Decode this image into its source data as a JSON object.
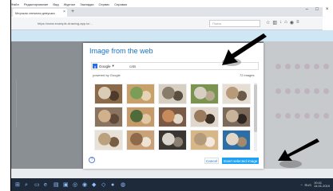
{
  "menubar": [
    "Файл",
    "Редактирование",
    "Вид",
    "Журнал",
    "Закладки",
    "Сервис",
    "Справка"
  ],
  "browser": {
    "tab_title": "Мерзкая снежная девушка",
    "url": "https://www.example-drawing-app.io/...",
    "search_placeholder": "Поиск"
  },
  "dialog": {
    "title": "Image from the web",
    "provider": "Google",
    "query": "cats",
    "powered_by": "powered by Google",
    "count": "72 images",
    "help": "?",
    "cancel_label": "Cancel",
    "insert_label": "Insert selected image"
  },
  "images": [
    {
      "colors": [
        "#8b6a4a",
        "#d9cbb5",
        "#4d3b2c"
      ]
    },
    {
      "colors": [
        "#c8a06a",
        "#7a9e58",
        "#e5d3b4"
      ]
    },
    {
      "colors": [
        "#d8cfc3",
        "#8a7c6a",
        "#5a4e40"
      ]
    },
    {
      "colors": [
        "#7a9450",
        "#d7d0c2",
        "#b9a890"
      ]
    },
    {
      "colors": [
        "#e7ded3",
        "#b79a7a",
        "#6b5a4a"
      ]
    },
    {
      "colors": [
        "#8a7460",
        "#d0b18c",
        "#5f4a3a"
      ]
    },
    {
      "colors": [
        "#c79a6a",
        "#4f6b3a",
        "#e2c9a6"
      ]
    },
    {
      "colors": [
        "#7a5a44",
        "#c78a5a",
        "#e2d8c8"
      ]
    },
    {
      "colors": [
        "#e0d6cc",
        "#9b7b5e",
        "#3e3228"
      ]
    },
    {
      "colors": [
        "#7b6a5a",
        "#c9b49a",
        "#2e2622"
      ]
    },
    {
      "colors": [
        "#e7e1d8",
        "#bca181",
        "#7a5e44"
      ]
    },
    {
      "colors": [
        "#c9a27a",
        "#8e6a4a",
        "#efe4d4"
      ]
    },
    {
      "colors": [
        "#3a3632",
        "#d9d4cc",
        "#8a7e70"
      ]
    },
    {
      "colors": [
        "#d7b688",
        "#b29a7a",
        "#f2e9dc"
      ]
    },
    {
      "colors": [
        "#2d6ea6",
        "#e2d6c6",
        "#a48a6a"
      ]
    }
  ],
  "taskbar": {
    "language": "RUS",
    "time": "10:41",
    "date": "14.01.2019"
  }
}
